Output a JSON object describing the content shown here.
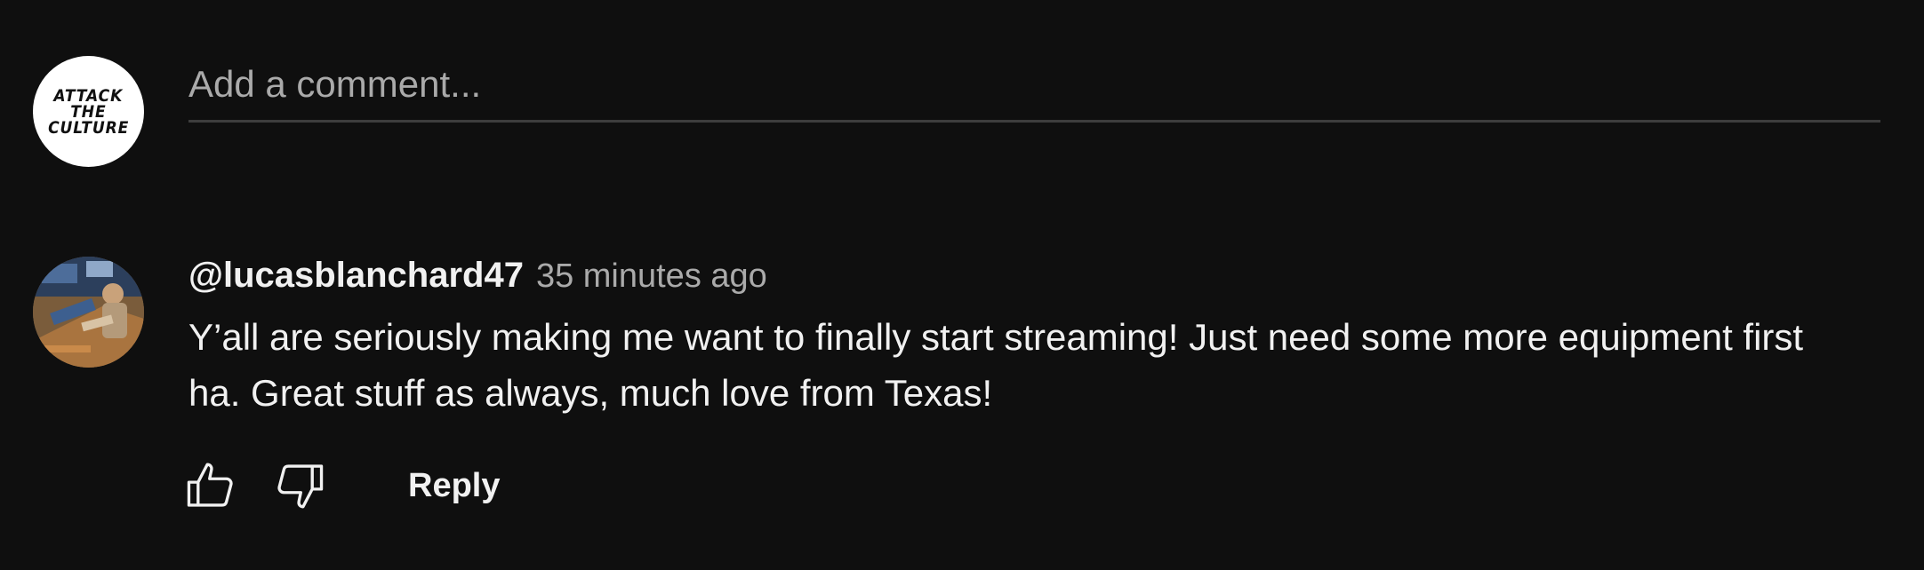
{
  "composer": {
    "avatar_logo_lines": [
      "ATTACK",
      "THE",
      "CULTURE"
    ],
    "placeholder": "Add a comment..."
  },
  "comment": {
    "author": "@lucasblanchard47",
    "timestamp": "35 minutes ago",
    "text": "Y’all are seriously making me want to finally start streaming! Just need some more equipment first ha. Great stuff as always, much love from Texas!",
    "avatar_icon": "user-photo-avatar"
  },
  "actions": {
    "like_icon": "thumbs-up-icon",
    "dislike_icon": "thumbs-down-icon",
    "reply_label": "Reply"
  },
  "colors": {
    "background": "#0f0f0f",
    "text_primary": "#f1f1f1",
    "text_secondary": "#aaaaaa",
    "divider": "#3d3d3d"
  }
}
